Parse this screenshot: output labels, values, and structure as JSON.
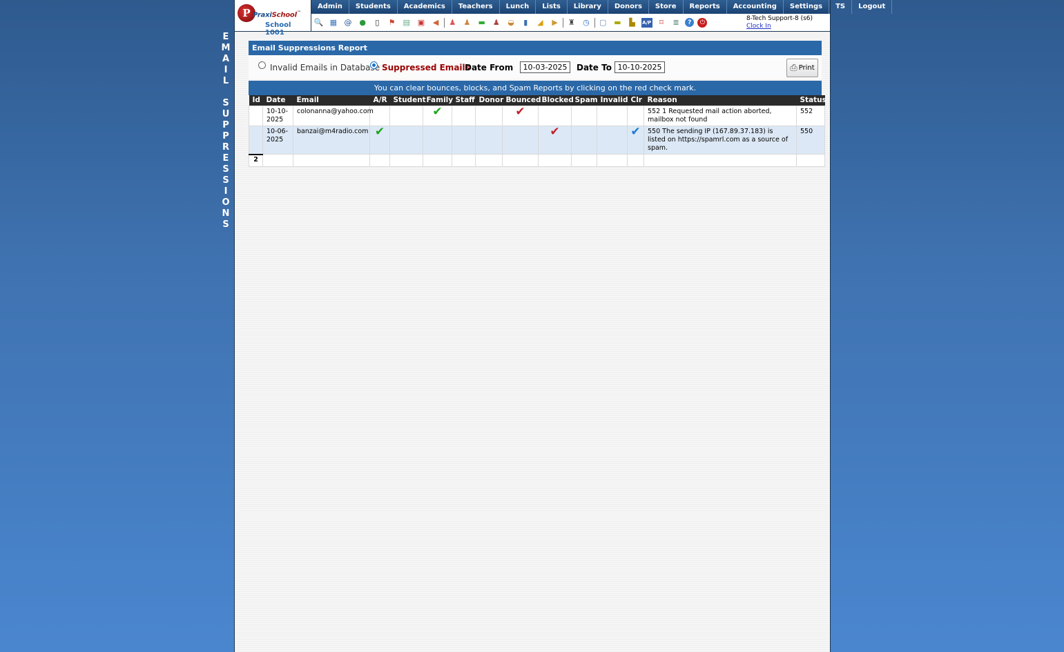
{
  "side_title": [
    "E",
    "M",
    "A",
    "I",
    "L",
    "",
    "S",
    "U",
    "P",
    "P",
    "R",
    "E",
    "S",
    "S",
    "I",
    "O",
    "N",
    "S"
  ],
  "logo": {
    "letter": "P",
    "brand_a": "Praxi",
    "brand_b": "School",
    "tm": "™",
    "school": "School 1001"
  },
  "menu": [
    "Admin",
    "Students",
    "Academics",
    "Teachers",
    "Lunch",
    "Lists",
    "Library",
    "Donors",
    "Store",
    "Reports",
    "Accounting",
    "Settings",
    "TS",
    "Logout"
  ],
  "toolbar_icons": [
    {
      "name": "search-icon",
      "glyph": "🔍",
      "color": "#555"
    },
    {
      "name": "calendar-grid-icon",
      "glyph": "▦",
      "color": "#3a78c0"
    },
    {
      "name": "email-at-icon",
      "glyph": "@",
      "color": "#1d4f8e"
    },
    {
      "name": "chat-icon",
      "glyph": "●",
      "color": "#2a9a3a"
    },
    {
      "name": "mobile-phone-icon",
      "glyph": "▯",
      "color": "#222"
    },
    {
      "name": "flag-icon",
      "glyph": "⚑",
      "color": "#c43"
    },
    {
      "name": "report-card-icon",
      "glyph": "▤",
      "color": "#6a8"
    },
    {
      "name": "calendar-icon",
      "glyph": "▣",
      "color": "#c33"
    },
    {
      "name": "megaphone-icon",
      "glyph": "◀",
      "color": "#c63"
    },
    {
      "name": "sep"
    },
    {
      "name": "student-icon",
      "glyph": "♟",
      "color": "#d55"
    },
    {
      "name": "teacher-icon",
      "glyph": "♟",
      "color": "#c84"
    },
    {
      "name": "money-icon",
      "glyph": "▬",
      "color": "#3a3"
    },
    {
      "name": "family-icon",
      "glyph": "♟",
      "color": "#a44"
    },
    {
      "name": "lunch-icon",
      "glyph": "◒",
      "color": "#c83"
    },
    {
      "name": "book-icon",
      "glyph": "▮",
      "color": "#3a6fb0"
    },
    {
      "name": "gift-icon",
      "glyph": "◢",
      "color": "#d9a010"
    },
    {
      "name": "store-icon",
      "glyph": "▶",
      "color": "#c93"
    },
    {
      "name": "sep"
    },
    {
      "name": "user-admin-icon",
      "glyph": "♜",
      "color": "#444"
    },
    {
      "name": "clock-icon",
      "glyph": "◷",
      "color": "#2a6fc0"
    },
    {
      "name": "sep"
    },
    {
      "name": "document-icon",
      "glyph": "▢",
      "color": "#6a8ab5"
    },
    {
      "name": "card-icon",
      "glyph": "▬",
      "color": "#aa0"
    },
    {
      "name": "bus-icon",
      "glyph": "▙",
      "color": "#a80"
    },
    {
      "name": "ap-icon",
      "glyph": "A/P",
      "color": "#fff"
    },
    {
      "name": "pdf-icon",
      "glyph": "⌑",
      "color": "#c22"
    },
    {
      "name": "stack-icon",
      "glyph": "≣",
      "color": "#476"
    },
    {
      "name": "help-icon",
      "glyph": "?",
      "color": "#fff"
    },
    {
      "name": "power-icon",
      "glyph": "⏻",
      "color": "#fff"
    }
  ],
  "user": {
    "name": "8-Tech Support-8 (s6)",
    "clock_in": "Clock In"
  },
  "report": {
    "title": "Email Suppressions Report",
    "option_invalid": "Invalid Emails in Database",
    "option_suppressed": "Suppressed Emails",
    "selected_option": "suppressed",
    "date_from_label": "Date From",
    "date_from": "10-03-2025",
    "date_to_label": "Date To",
    "date_to": "10-10-2025",
    "print_label": "Print",
    "note": "You can clear bounces, blocks, and Spam Reports by clicking on the red check mark.",
    "columns": [
      "Id",
      "Date",
      "Email",
      "A/R",
      "Student",
      "Family",
      "Staff",
      "Donor",
      "Bounced",
      "Blocked",
      "Spam",
      "Invalid",
      "Clr",
      "Reason",
      "Status"
    ],
    "rows": [
      {
        "id": "",
        "date": "10-10-2025",
        "email": "colonanna@yahoo.com",
        "ar": "",
        "student": "",
        "family": "green",
        "staff": "",
        "donor": "",
        "bounced": "red",
        "blocked": "",
        "spam": "",
        "invalid": "",
        "clr": "",
        "reason": "552 1 Requested mail action aborted, mailbox not found",
        "status": "552"
      },
      {
        "id": "",
        "date": "10-06-2025",
        "email": "banzai@m4radio.com",
        "ar": "green",
        "student": "",
        "family": "",
        "staff": "",
        "donor": "",
        "bounced": "",
        "blocked": "red",
        "spam": "",
        "invalid": "",
        "clr": "blue",
        "reason": "550 The sending IP (167.89.37.183) is listed on https://spamrl.com as a source of spam.",
        "status": "550"
      }
    ],
    "total_count": "2",
    "check_colors": {
      "green": "#1aa51a",
      "red": "#c0202a",
      "blue": "#1a7ad0"
    },
    "check_glyph": "✔"
  }
}
